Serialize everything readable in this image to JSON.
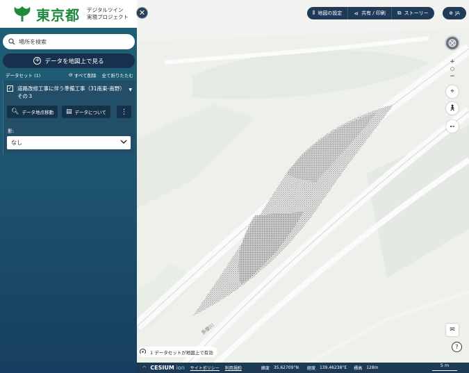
{
  "brand": {
    "logo": "東京都",
    "subtitle_line1": "デジタルツイン",
    "subtitle_line2": "実現プロジェクト"
  },
  "search": {
    "placeholder": "場所を検索"
  },
  "add_data_button": "データを地図上で見る",
  "dataset_header": {
    "title": "データセット (1)",
    "remove_all": "すべて削除",
    "collapse_all": "全て折りたたむ"
  },
  "dataset": {
    "name": "道路改修工事に伴う準備工事（31南東-南野）その３",
    "zoom_button": "データ地点移動",
    "info_button": "データについて",
    "shadow_label": "影:",
    "shadow_value": "なし"
  },
  "topbar": {
    "map_settings": "地図の設定",
    "share": "共有 / 印刷",
    "story": "ストーリー",
    "lang": "JA"
  },
  "controls": {
    "zoom_in": "+",
    "zoom_reset": "○",
    "zoom_out": "−"
  },
  "notice": "1 データセットが地図上で有効",
  "statusbar": {
    "privacy": "サイトポリシー",
    "terms": "利用規約",
    "lat_label": "緯度",
    "lat": "35.62709°N",
    "lon_label": "経度",
    "lon": "139.46238°E",
    "elev_label": "標高",
    "elev": "128m",
    "scale": "5 m",
    "cesium": "CESIUM",
    "ion": "ion"
  },
  "map_labels": [
    "多摩川"
  ],
  "colors": {
    "sidebar_top": "#1f6176",
    "sidebar_bottom": "#173e60",
    "topbar": "#1f3b57",
    "tokyo_green": "#1f8a3c"
  }
}
